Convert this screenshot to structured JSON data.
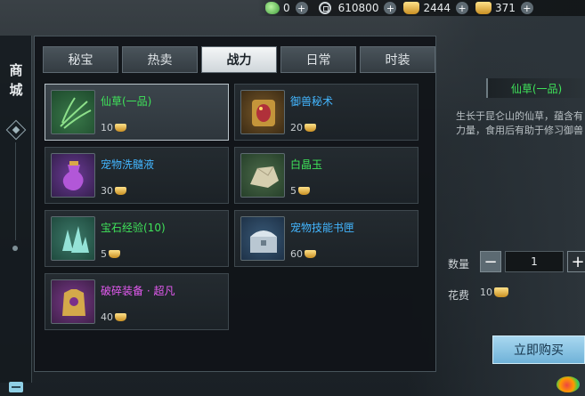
{
  "currencies": [
    {
      "icon": "jade-currency-icon",
      "value": "0"
    },
    {
      "icon": "silver-coin-icon",
      "value": "610800"
    },
    {
      "icon": "gold-ingot-icon",
      "value": "2444"
    },
    {
      "icon": "bound-gold-ingot-icon",
      "value": "371"
    }
  ],
  "sidebar": {
    "title": "商城"
  },
  "tabs": [
    {
      "label": "秘宝",
      "active": false
    },
    {
      "label": "热卖",
      "active": false
    },
    {
      "label": "战力",
      "active": true
    },
    {
      "label": "日常",
      "active": false
    },
    {
      "label": "时装",
      "active": false
    }
  ],
  "items": [
    {
      "name": "仙草(一品)",
      "price": "10",
      "quality": "green",
      "icon": "herb-icon",
      "selected": true
    },
    {
      "name": "御兽秘术",
      "price": "20",
      "quality": "blue",
      "icon": "beast-scroll-icon",
      "selected": false
    },
    {
      "name": "宠物洗髓液",
      "price": "30",
      "quality": "blue",
      "icon": "potion-icon",
      "selected": false
    },
    {
      "name": "白晶玉",
      "price": "5",
      "quality": "green",
      "icon": "jade-stone-icon",
      "selected": false
    },
    {
      "name": "宝石经验(10)",
      "price": "5",
      "quality": "green",
      "icon": "crystal-icon",
      "selected": false
    },
    {
      "name": "宠物技能书匣",
      "price": "60",
      "quality": "blue",
      "icon": "chest-icon",
      "selected": false
    },
    {
      "name": "破碎装备 · 超凡",
      "price": "40",
      "quality": "purple",
      "icon": "armor-icon",
      "selected": false
    }
  ],
  "detail": {
    "title": "仙草(一品)",
    "desc_line1": "生长于昆仑山的仙草，蕴含有",
    "desc_line2": "力量，食用后有助于修习御兽",
    "qty_label": "数量",
    "qty_value": "1",
    "minus": "−",
    "plus": "+",
    "cost_label": "花费",
    "cost_value": "10",
    "buy_label": "立即购买"
  },
  "colors": {
    "green": "#3fe35a",
    "blue": "#43b6ff",
    "purple": "#e65bf3",
    "tab_active": "#e8ecee"
  }
}
